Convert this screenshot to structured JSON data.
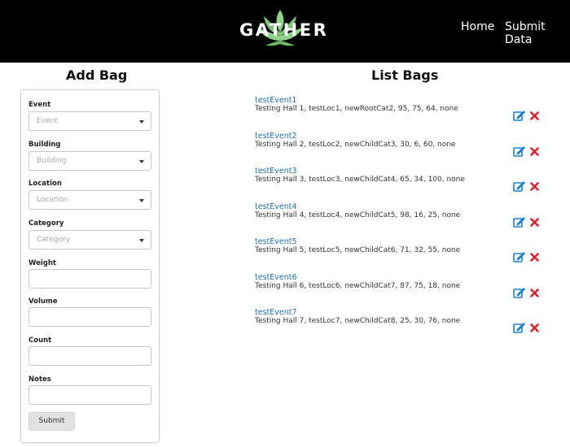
{
  "header": {
    "logo_text": "GATHER",
    "nav": {
      "home": "Home",
      "submit_data": "Submit Data"
    }
  },
  "add_bag": {
    "title": "Add Bag",
    "fields": {
      "event": {
        "label": "Event",
        "placeholder": "Event"
      },
      "building": {
        "label": "Building",
        "placeholder": "Building"
      },
      "location": {
        "label": "Location",
        "placeholder": "Location"
      },
      "category": {
        "label": "Category",
        "placeholder": "Category"
      },
      "weight": {
        "label": "Weight",
        "value": ""
      },
      "volume": {
        "label": "Volume",
        "value": ""
      },
      "count": {
        "label": "Count",
        "value": ""
      },
      "notes": {
        "label": "Notes",
        "value": ""
      }
    },
    "submit_label": "Submit"
  },
  "list_bags": {
    "title": "List Bags",
    "items": [
      {
        "event": "testEvent1",
        "details": "Testing Hall 1, testLoc1, newRootCat2, 95, 75, 64, none"
      },
      {
        "event": "testEvent2",
        "details": "Testing Hall 2, testLoc2, newChildCat3, 30, 6, 60, none"
      },
      {
        "event": "testEvent3",
        "details": "Testing Hall 3, testLoc3, newChildCat4, 65, 34, 100, none"
      },
      {
        "event": "testEvent4",
        "details": "Testing Hall 4, testLoc4, newChildCat5, 98, 16, 25, none"
      },
      {
        "event": "testEvent5",
        "details": "Testing Hall 5, testLoc5, newChildCat6, 71, 32, 55, none"
      },
      {
        "event": "testEvent6",
        "details": "Testing Hall 6, testLoc6, newChildCat7, 87, 75, 18, none"
      },
      {
        "event": "testEvent7",
        "details": "Testing Hall 7, testLoc7, newChildCat8, 25, 30, 76, none"
      }
    ]
  },
  "icons": {
    "edit": "edit-icon",
    "delete": "delete-icon"
  },
  "colors": {
    "header_bg": "#000000",
    "link": "#1e6fb5",
    "edit": "#1e7fc9",
    "delete": "#d9202a",
    "logo_leaf": "#8fd18a"
  }
}
